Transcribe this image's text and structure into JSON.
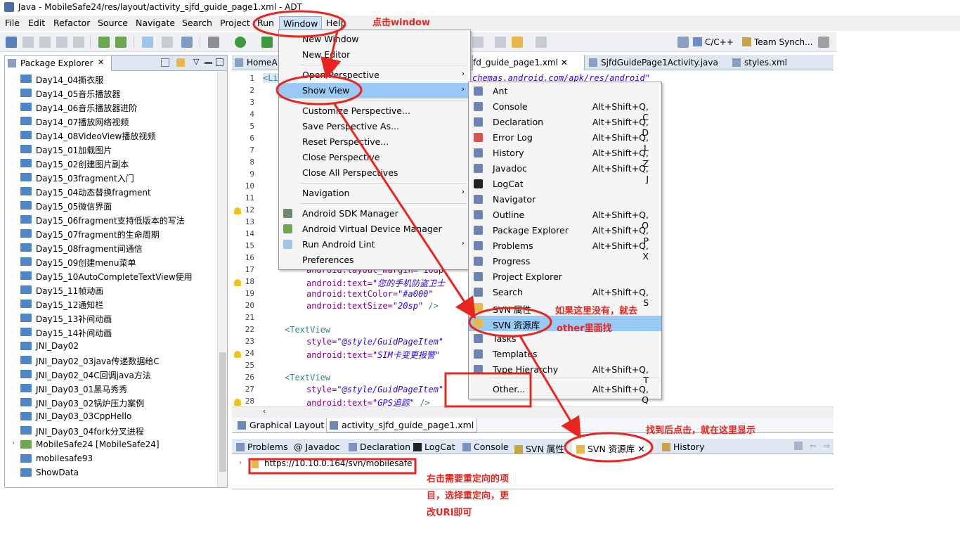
{
  "titlebar": {
    "title": "Java - MobileSafe24/res/layout/activity_sjfd_guide_page1.xml - ADT"
  },
  "menubar": {
    "items": [
      "File",
      "Edit",
      "Refactor",
      "Source",
      "Navigate",
      "Search",
      "Project",
      "Run",
      "Window",
      "Help"
    ]
  },
  "toolbar": {
    "perspectives": [
      "C/C++",
      "Team Synch..."
    ]
  },
  "package_explorer": {
    "title": "Package Explorer",
    "items": [
      "Day14_04撕衣服",
      "Day14_05音乐播放器",
      "Day14_06音乐播放器进阶",
      "Day14_07播放网络视频",
      "Day14_08VideoView播放视频",
      "Day15_01加载图片",
      "Day15_02创建图片副本",
      "Day15_03fragment入门",
      "Day15_04动态替换fragment",
      "Day15_05微信界面",
      "Day15_06fragment支持低版本的写法",
      "Day15_07fragment的生命周期",
      "Day15_08fragment间通信",
      "Day15_09创建menu菜单",
      "Day15_10AutoCompleteTextView使用",
      "Day15_11帧动画",
      "Day15_12通知栏",
      "Day15_13补间动画",
      "Day15_14补间动画",
      "JNI_Day02",
      "JNI_Day02_03java传递数据给C",
      "JNI_Day02_04C回调java方法",
      "JNI_Day03_01黑马秀秀",
      "JNI_Day03_02锅炉压力案例",
      "JNI_Day03_03CppHello",
      "JNI_Day03_04fork分叉进程",
      "MobileSafe24 [MobileSafe24]",
      "mobilesafe93",
      "ShowData"
    ]
  },
  "editor": {
    "tabs": [
      "HomeA",
      "fd_guide_page1.xml",
      "SjfdGuidePage1Activity.java",
      "styles.xml"
    ],
    "line_numbers": [
      "1",
      "2",
      "3",
      "4",
      "5",
      "6",
      "7",
      "8",
      "9",
      "10",
      "11",
      "12",
      "13",
      "14",
      "15",
      "16",
      "17",
      "18",
      "19",
      "20",
      "21",
      "22",
      "23",
      "24",
      "25",
      "26",
      "27",
      "28"
    ],
    "code": {
      "l1_tag": "<Li",
      "l1_rest": "chemas.android.com/apk/res/android\"",
      "l17": "android:layout_margin=\"10dp\"",
      "l18_attr": "android:text=",
      "l18_val": "\"您的手机防盗卫士",
      "l19_attr": "android:textColor=",
      "l19_val": "\"#a000\"",
      "l20_attr": "android:textSize=",
      "l20_val": "\"20sp\"",
      "l20_end": " />",
      "l22": "<TextView",
      "l23_attr": "style=",
      "l23_val": "\"@style/GuidPageItem\"",
      "l24_attr": "android:text=",
      "l24_val": "\"SIM卡变更报警\"",
      "l26": "<TextView",
      "l27_attr": "style=",
      "l27_val": "\"@style/GuidPageItem\"",
      "l28_attr": "android:text=",
      "l28_val": "\"GPS追踪\"",
      "l28_end": " />"
    },
    "bottom_tabs": [
      "Graphical Layout",
      "activity_sjfd_guide_page1.xml"
    ]
  },
  "views": {
    "tabs": [
      "Problems",
      "Javadoc",
      "Declaration",
      "LogCat",
      "Console",
      "SVN 属性",
      "SVN 资源库",
      "History"
    ],
    "repo_url": "https://10.10.0.164/svn/mobilesafe"
  },
  "window_menu": {
    "items": [
      "New Window",
      "New Editor",
      "Open Perspective",
      "Show View",
      "Customize Perspective...",
      "Save Perspective As...",
      "Reset Perspective...",
      "Close Perspective",
      "Close All Perspectives",
      "Navigation",
      "Android SDK Manager",
      "Android Virtual Device Manager",
      "Run Android Lint",
      "Preferences"
    ]
  },
  "show_view_menu": {
    "items": [
      {
        "label": "Ant",
        "key": ""
      },
      {
        "label": "Console",
        "key": "Alt+Shift+Q, C"
      },
      {
        "label": "Declaration",
        "key": "Alt+Shift+Q, D"
      },
      {
        "label": "Error Log",
        "key": "Alt+Shift+Q, L"
      },
      {
        "label": "History",
        "key": "Alt+Shift+Q, Z"
      },
      {
        "label": "Javadoc",
        "key": "Alt+Shift+Q, J"
      },
      {
        "label": "LogCat",
        "key": ""
      },
      {
        "label": "Navigator",
        "key": ""
      },
      {
        "label": "Outline",
        "key": "Alt+Shift+Q, O"
      },
      {
        "label": "Package Explorer",
        "key": "Alt+Shift+Q, P"
      },
      {
        "label": "Problems",
        "key": "Alt+Shift+Q, X"
      },
      {
        "label": "Progress",
        "key": ""
      },
      {
        "label": "Project Explorer",
        "key": ""
      },
      {
        "label": "Search",
        "key": "Alt+Shift+Q, S"
      },
      {
        "label": "SVN 属性",
        "key": ""
      },
      {
        "label": "SVN 资源库",
        "key": ""
      },
      {
        "label": "Tasks",
        "key": ""
      },
      {
        "label": "Templates",
        "key": ""
      },
      {
        "label": "Type Hierarchy",
        "key": "Alt+Shift+Q, T"
      },
      {
        "label": "Other...",
        "key": "Alt+Shift+Q, Q"
      }
    ]
  },
  "annotations": {
    "click_window": "点击window",
    "if_missing_1": "如果这里没有，就去",
    "if_missing_2": "other里面找",
    "found_click": "找到后点击，就在这里显示",
    "relocate_1": "右击需要重定向的项",
    "relocate_2": "目，选择重定向，更",
    "relocate_3": "改URI即可"
  },
  "colors": {
    "annotation": "#e8261f",
    "highlight": "#99c9f5",
    "folder": "#4d86c9"
  }
}
